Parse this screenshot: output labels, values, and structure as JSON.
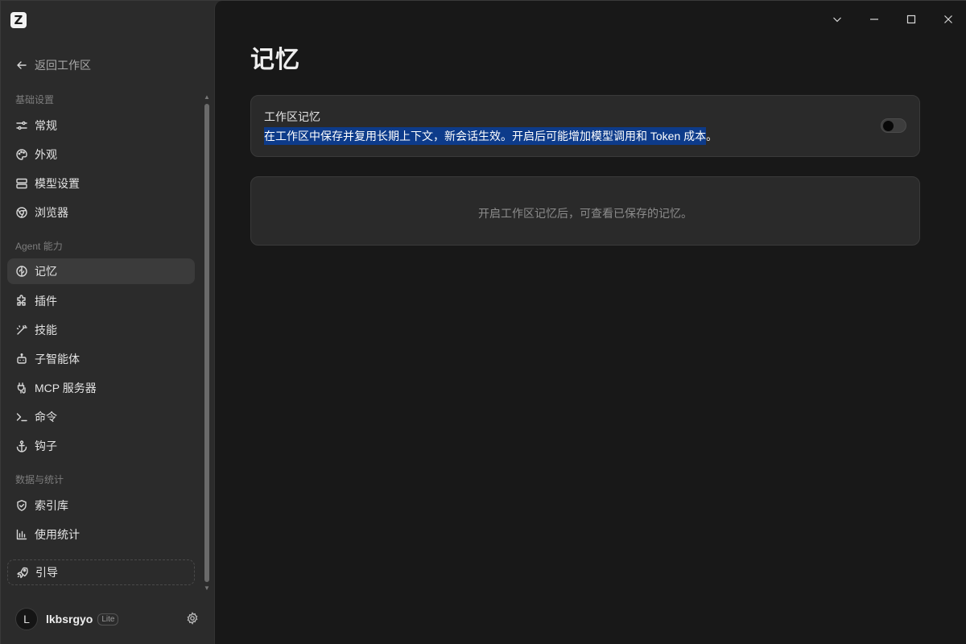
{
  "app": {
    "logo_letter": "Z"
  },
  "sidebar": {
    "back_label": "返回工作区",
    "sections": {
      "basic": "基础设置",
      "agent": "Agent 能力",
      "data": "数据与统计"
    },
    "items": {
      "general": "常规",
      "appearance": "外观",
      "model": "模型设置",
      "browser": "浏览器",
      "memory": "记忆",
      "plugins": "插件",
      "skills": "技能",
      "subagents": "子智能体",
      "mcp": "MCP 服务器",
      "commands": "命令",
      "hooks": "钩子",
      "index": "索引库",
      "usage": "使用统计"
    },
    "active_item": "memory",
    "guide_label": "引导",
    "user": {
      "avatar_letter": "L",
      "name": "lkbsrgyo",
      "plan": "Lite"
    }
  },
  "main": {
    "title": "记忆",
    "toggle_card": {
      "title": "工作区记忆",
      "description_selected": "在工作区中保存并复用长期上下文，新会话生效。开启后可能增加模型调用和 Token 成本",
      "description_tail": "。",
      "enabled": false
    },
    "empty_state": "开启工作区记忆后，可查看已保存的记忆。"
  },
  "colors": {
    "selection": "#0d3b8a",
    "background": "#181818",
    "sidebar": "#2b2b2b"
  }
}
